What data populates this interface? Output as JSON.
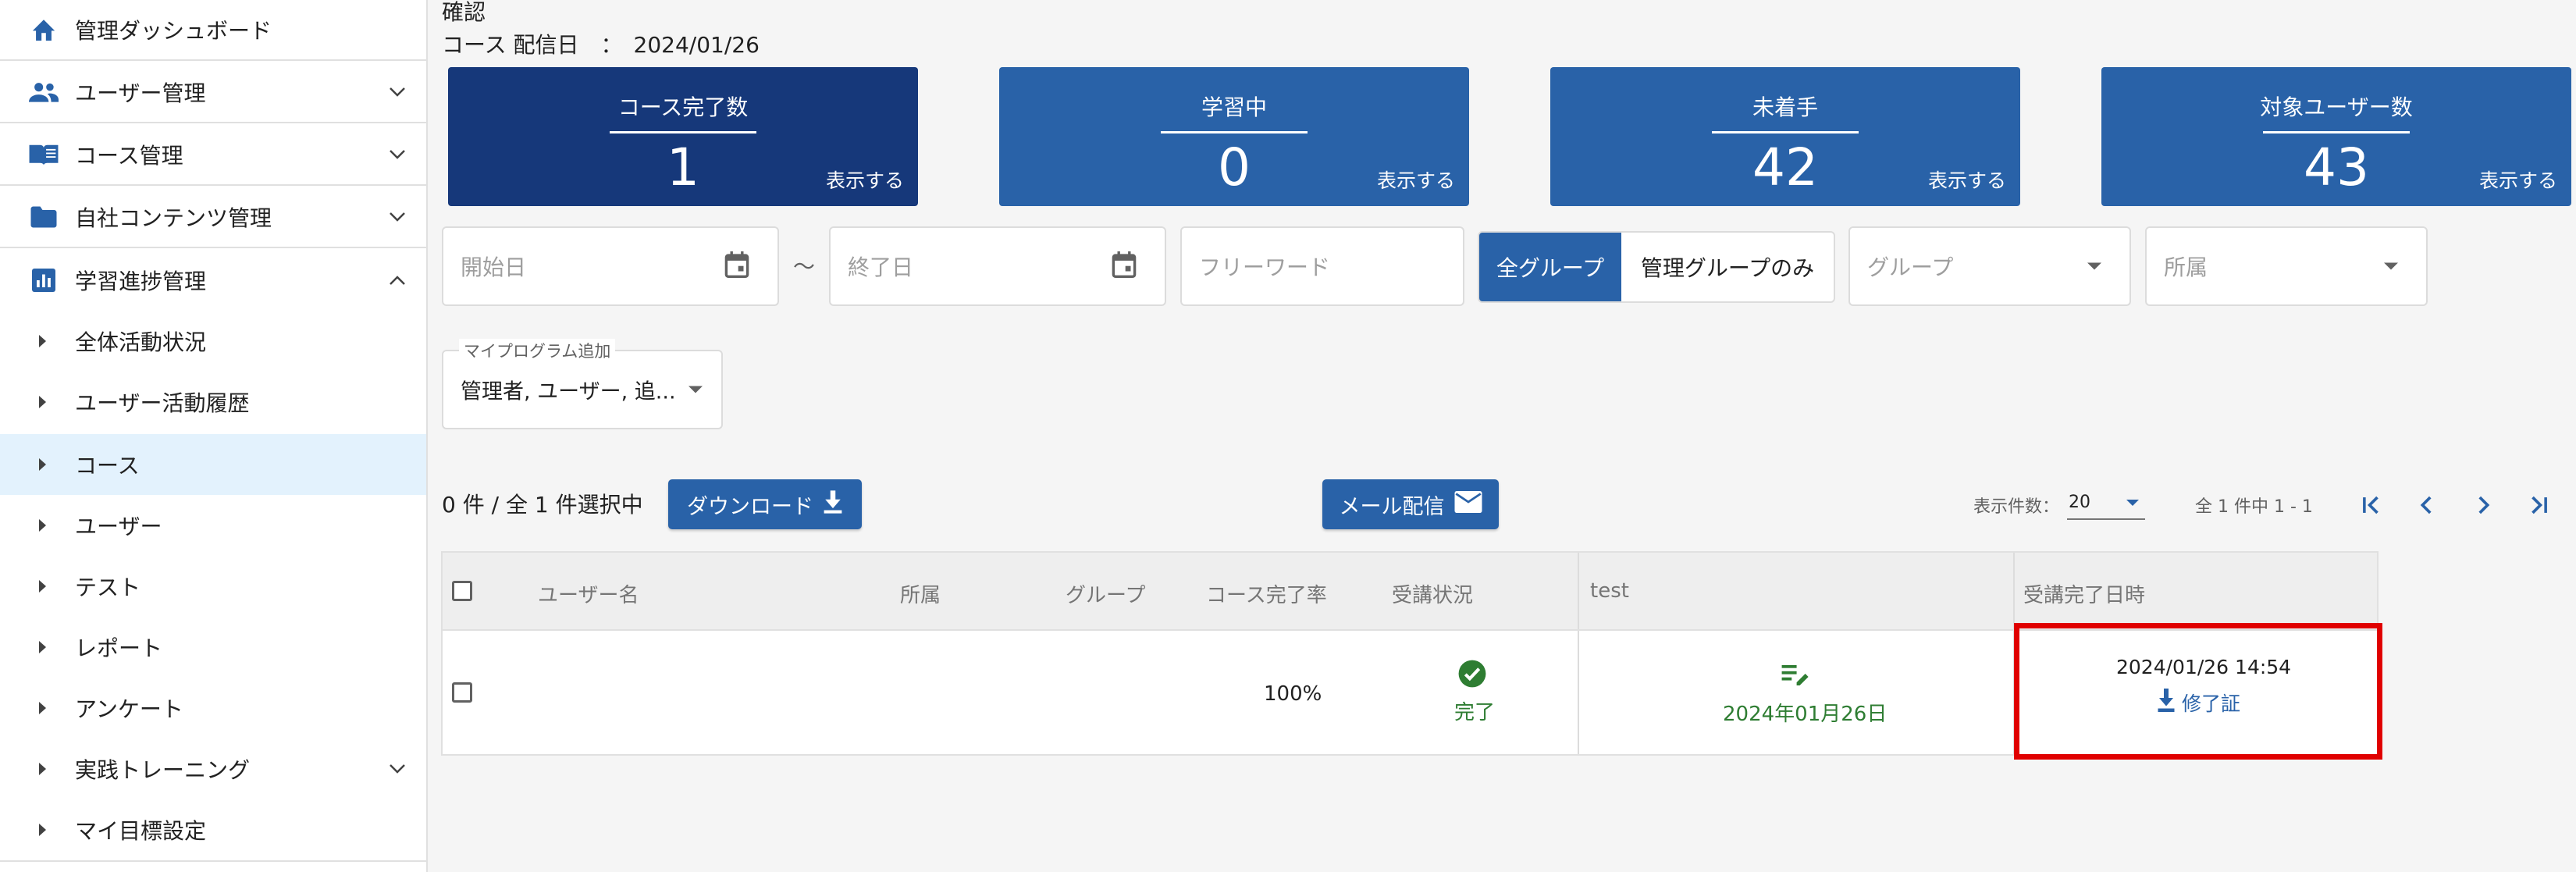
{
  "sidebar": {
    "items": [
      {
        "label": "管理ダッシュボード",
        "icon": "home-icon"
      },
      {
        "label": "ユーザー管理",
        "icon": "people-icon"
      },
      {
        "label": "コース管理",
        "icon": "book-icon"
      },
      {
        "label": "自社コンテンツ管理",
        "icon": "folder-icon"
      },
      {
        "label": "学習進捗管理",
        "icon": "bar-chart-icon"
      }
    ],
    "sub_items": [
      {
        "label": "全体活動状況"
      },
      {
        "label": "ユーザー活動履歴"
      },
      {
        "label": "コース"
      },
      {
        "label": "ユーザー"
      },
      {
        "label": "テスト"
      },
      {
        "label": "レポート"
      },
      {
        "label": "アンケート"
      },
      {
        "label": "実践トレーニング"
      },
      {
        "label": "マイ目標設定"
      }
    ]
  },
  "header": {
    "title": "確認",
    "delivery_label": "コース 配信日　：　2024/01/26"
  },
  "stats": [
    {
      "title": "コース完了数",
      "value": "1",
      "link": "表示する"
    },
    {
      "title": "学習中",
      "value": "0",
      "link": "表示する"
    },
    {
      "title": "未着手",
      "value": "42",
      "link": "表示する"
    },
    {
      "title": "対象ユーザー数",
      "value": "43",
      "link": "表示する"
    }
  ],
  "filters": {
    "start_date_placeholder": "開始日",
    "range_separator": "～",
    "end_date_placeholder": "終了日",
    "freeword_placeholder": "フリーワード",
    "group_toggle": {
      "all": "全グループ",
      "managed": "管理グループのみ"
    },
    "group_placeholder": "グループ",
    "affiliation_placeholder": "所属",
    "my_program_label": "マイプログラム追加",
    "my_program_value": "管理者, ユーザー, 追..."
  },
  "toolbar": {
    "selection_text": "0 件 / 全 1 件選択中",
    "download_label": "ダウンロード",
    "mail_label": "メール配信",
    "rows_per_page_label": "表示件数：",
    "rows_per_page_value": "20",
    "page_info": "全 1 件中 1 - 1"
  },
  "table": {
    "columns": [
      "ユーザー名",
      "所属",
      "グループ",
      "コース完了率",
      "受講状況",
      "test",
      "受講完了日時"
    ],
    "rows": [
      {
        "user_name": "",
        "affiliation": "",
        "group": "",
        "completion_rate": "100%",
        "status": "完了",
        "test_date": "2024年01月26日",
        "completed_at": "2024/01/26 14:54",
        "certificate_label": "修了証"
      }
    ]
  },
  "colors": {
    "primary": "#2962a8",
    "primary_dark": "#16387a",
    "success": "#2e7d32",
    "highlight": "#e00000"
  }
}
